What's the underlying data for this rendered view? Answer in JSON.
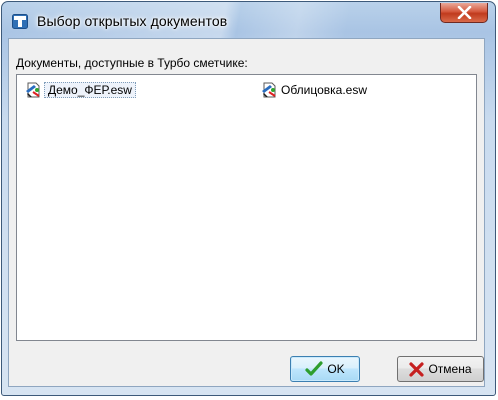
{
  "window": {
    "title": "Выбор открытых документов"
  },
  "list": {
    "caption": "Документы, доступные в Турбо сметчике:",
    "items": [
      {
        "label": "Демо_ФЕР.esw",
        "icon": "estimate-file-icon",
        "selected": true
      },
      {
        "label": "Облицовка.esw",
        "icon": "estimate-file-icon",
        "selected": false
      }
    ]
  },
  "buttons": {
    "ok": {
      "label": "OK",
      "icon": "checkmark-icon",
      "icon_color": "#2e9e2e"
    },
    "cancel": {
      "label": "Отмена",
      "icon": "cross-icon",
      "icon_color": "#c62020"
    }
  },
  "colors": {
    "title_bar": "#b9d1ea",
    "close_button": "#c9462b",
    "dialog_face": "#f0f0f0",
    "ok_button_border": "#3c7fb1"
  }
}
